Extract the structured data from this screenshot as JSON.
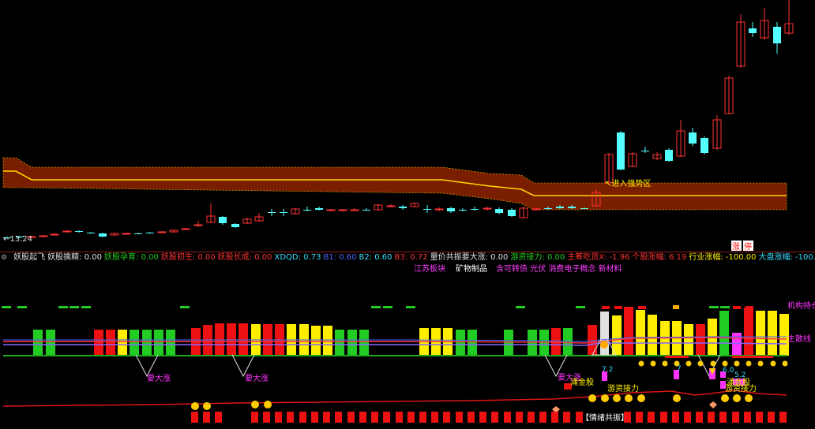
{
  "colors": {
    "up": "#ff3333",
    "down": "#54ffff",
    "band_fill": "#7a1e00",
    "band_line": "#ffd700",
    "green": "#22cc22",
    "yellow": "#ffee00",
    "red": "#ee1111",
    "magenta": "#ff33ff",
    "status_green": "#22cc22",
    "status_red": "#ff3333",
    "status_white": "#e0e0e0",
    "status_cyan": "#33ddff",
    "status_blue": "#4a6aff",
    "status_yellow": "#ffee00"
  },
  "main_chart": {
    "min_label": "←13.24",
    "band_annotation": "↖进入强势区",
    "tag_rise": "涨",
    "tag_stop": "停"
  },
  "indicator_bar": {
    "items": [
      {
        "text": "妖股起飞",
        "color": "status_white"
      },
      {
        "text": "妖股擒精: 0.00",
        "color": "status_white"
      },
      {
        "text": "妖股孕育: 0.00",
        "color": "status_green"
      },
      {
        "text": "妖股初生: 0.00",
        "color": "status_red"
      },
      {
        "text": "妖股长成: 0.00",
        "color": "status_red"
      },
      {
        "text": "XDQD: 0.73",
        "color": "status_cyan"
      },
      {
        "text": "B1: 0.60",
        "color": "status_blue"
      },
      {
        "text": "B2: 0.60",
        "color": "status_cyan"
      },
      {
        "text": "B3: 0.72",
        "color": "status_red"
      },
      {
        "text": "量价共振要大涨: 0.00",
        "color": "status_white"
      },
      {
        "text": "游资接力: 0.00",
        "color": "status_green"
      },
      {
        "text": "主筹吃货X: -1.96",
        "color": "status_red"
      },
      {
        "text": "个股涨幅: 6.19",
        "color": "status_red"
      },
      {
        "text": "行业涨幅: -100.00",
        "color": "status_yellow"
      },
      {
        "text": "大盘涨幅: -100.00",
        "color": "status_cyan"
      }
    ],
    "sectors": [
      "江苏板块",
      "矿物制品",
      "含可转债 光伏 消费电子概念 新材料"
    ]
  },
  "lower_chart": {
    "label_institution": "机构持仓",
    "label_main_line": "主散线",
    "label_wait_rise": "要大涨",
    "label_hot_stock": "涌金股",
    "label_relay": "游资接力",
    "label_sentiment": "【情绪共振】",
    "label_72": "7.2",
    "label_60": "6.0",
    "label_52": "5.2",
    "label_7": "7"
  }
}
